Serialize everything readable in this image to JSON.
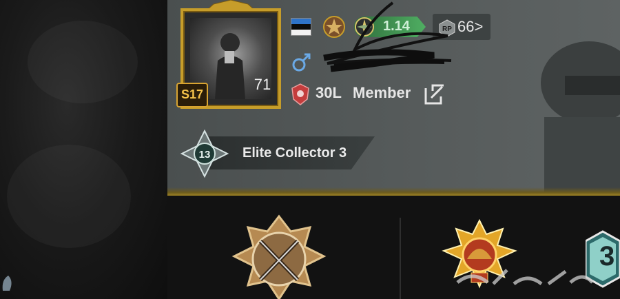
{
  "header": {
    "season_badge": "S17",
    "avatar_level": "71",
    "rank_tier": "1.14",
    "rp_level": "66>"
  },
  "crew": {
    "name": "30L",
    "role": "Member"
  },
  "title": {
    "label": "Elite Collector 3",
    "emblem_number": "13"
  },
  "achievements": {
    "right_label": "3"
  },
  "icons": {
    "flag": "estonia-flag-icon",
    "gender": "male-icon",
    "edit": "edit-icon",
    "rp": "rp-icon",
    "compass": "compass-icon"
  },
  "colors": {
    "gold": "#c69d2a",
    "rank_green": "#4fae62",
    "panel": "#565b5b",
    "background": "#151515"
  }
}
